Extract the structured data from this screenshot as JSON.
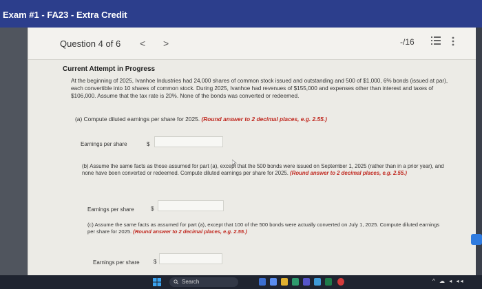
{
  "window": {
    "title": "Exam #1 - FA23 - Extra Credit"
  },
  "header": {
    "question_label": "Question 4 of 6",
    "prev_symbol": "<",
    "next_symbol": ">",
    "score": "-/16"
  },
  "attempt_label": "Current Attempt in Progress",
  "problem_text": "At the beginning of 2025, Ivanhoe Industries had 24,000 shares of common stock issued and outstanding and 500 of $1,000, 6% bonds (issued at par), each convertible into 10 shares of common stock. During 2025, Ivanhoe had revenues of $155,000 and expenses other than interest and taxes of $106,000. Assume that the tax rate is 20%. None of the bonds was converted or redeemed.",
  "parts": [
    {
      "text": "(a) Compute diluted earnings per share for 2025.",
      "note": "(Round answer to 2 decimal places, e.g. 2.55.)",
      "answer_label": "Earnings per share",
      "currency": "$",
      "value": ""
    },
    {
      "text": "(b) Assume the same facts as those assumed for part (a), except that the 500 bonds were issued on September 1, 2025 (rather than in a prior year), and none have been converted or redeemed. Compute diluted earnings per share for 2025.",
      "note": "(Round answer to 2 decimal places, e.g. 2.55.)",
      "answer_label": "Earnings per share",
      "currency": "$",
      "value": ""
    },
    {
      "text": "(c) Assume the same facts as assumed for part (a), except that 100 of the 500 bonds were actually converted on July 1, 2025. Compute diluted earnings per share for 2025.",
      "note": "(Round answer to 2 decimal places, e.g. 2.55.)",
      "answer_label": "Earnings per share",
      "currency": "$",
      "value": ""
    }
  ],
  "taskbar": {
    "search_label": "Search",
    "tray": "^ ☁ ◂ ◂◂",
    "colors": {
      "accent": "#2c3e8c",
      "note_red": "#c0281f"
    }
  }
}
